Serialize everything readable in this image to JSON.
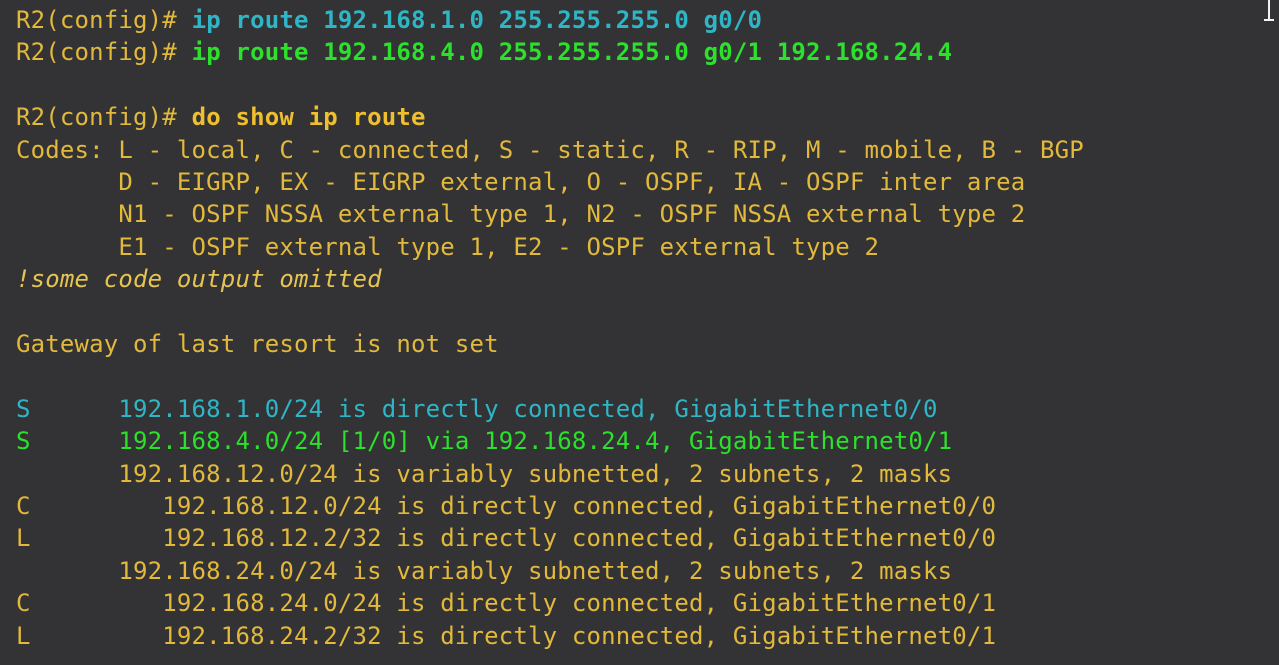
{
  "terminal": {
    "background_color": "#333336",
    "colors": {
      "gold": "#e2b93b",
      "cyan": "#2fb6c6",
      "green": "#2ce02c",
      "bold_gold": "#f0bf2e",
      "italic_gold": "#e6c452"
    },
    "prompt": "R2(config)#",
    "cursor_icon": "text-cursor-icon",
    "lines": [
      {
        "row": 0,
        "segments": [
          {
            "text": "R2(config)# ",
            "style": "gold"
          },
          {
            "text": "ip route 192.168.1.0 255.255.255.0 g0/0",
            "style": "cyan-bold"
          }
        ]
      },
      {
        "row": 1,
        "segments": [
          {
            "text": "R2(config)# ",
            "style": "gold"
          },
          {
            "text": "ip route 192.168.4.0 255.255.255.0 g0/1 192.168.24.4",
            "style": "green-bold"
          }
        ]
      },
      {
        "row": 2,
        "segments": []
      },
      {
        "row": 3,
        "segments": [
          {
            "text": "R2(config)# ",
            "style": "gold"
          },
          {
            "text": "do show ip route",
            "style": "gold-bold"
          }
        ]
      },
      {
        "row": 4,
        "segments": [
          {
            "text": "Codes: L - local, C - connected, S - static, R - RIP, M - mobile, B - BGP",
            "style": "gold"
          }
        ]
      },
      {
        "row": 5,
        "segments": [
          {
            "text": "       D - EIGRP, EX - EIGRP external, O - OSPF, IA - OSPF inter area",
            "style": "gold"
          }
        ]
      },
      {
        "row": 6,
        "segments": [
          {
            "text": "       N1 - OSPF NSSA external type 1, N2 - OSPF NSSA external type 2",
            "style": "gold"
          }
        ]
      },
      {
        "row": 7,
        "segments": [
          {
            "text": "       E1 - OSPF external type 1, E2 - OSPF external type 2",
            "style": "gold"
          }
        ]
      },
      {
        "row": 8,
        "segments": [
          {
            "text": "!some code output omitted",
            "style": "gold-italic"
          }
        ]
      },
      {
        "row": 9,
        "segments": []
      },
      {
        "row": 10,
        "segments": [
          {
            "text": "Gateway of last resort is not set",
            "style": "gold"
          }
        ]
      },
      {
        "row": 11,
        "segments": []
      },
      {
        "row": 12,
        "segments": [
          {
            "text": "S      192.168.1.0/24 is directly connected, GigabitEthernet0/0",
            "style": "cyan"
          }
        ]
      },
      {
        "row": 13,
        "segments": [
          {
            "text": "S      192.168.4.0/24 [1/0] via 192.168.24.4, GigabitEthernet0/1",
            "style": "green"
          }
        ]
      },
      {
        "row": 14,
        "segments": [
          {
            "text": "       192.168.12.0/24 is variably subnetted, 2 subnets, 2 masks",
            "style": "gold"
          }
        ]
      },
      {
        "row": 15,
        "segments": [
          {
            "text": "C         192.168.12.0/24 is directly connected, GigabitEthernet0/0",
            "style": "gold"
          }
        ]
      },
      {
        "row": 16,
        "segments": [
          {
            "text": "L         192.168.12.2/32 is directly connected, GigabitEthernet0/0",
            "style": "gold"
          }
        ]
      },
      {
        "row": 17,
        "segments": [
          {
            "text": "       192.168.24.0/24 is variably subnetted, 2 subnets, 2 masks",
            "style": "gold"
          }
        ]
      },
      {
        "row": 18,
        "segments": [
          {
            "text": "C         192.168.24.0/24 is directly connected, GigabitEthernet0/1",
            "style": "gold"
          }
        ]
      },
      {
        "row": 19,
        "segments": [
          {
            "text": "L         192.168.24.2/32 is directly connected, GigabitEthernet0/1",
            "style": "gold"
          }
        ]
      }
    ]
  }
}
